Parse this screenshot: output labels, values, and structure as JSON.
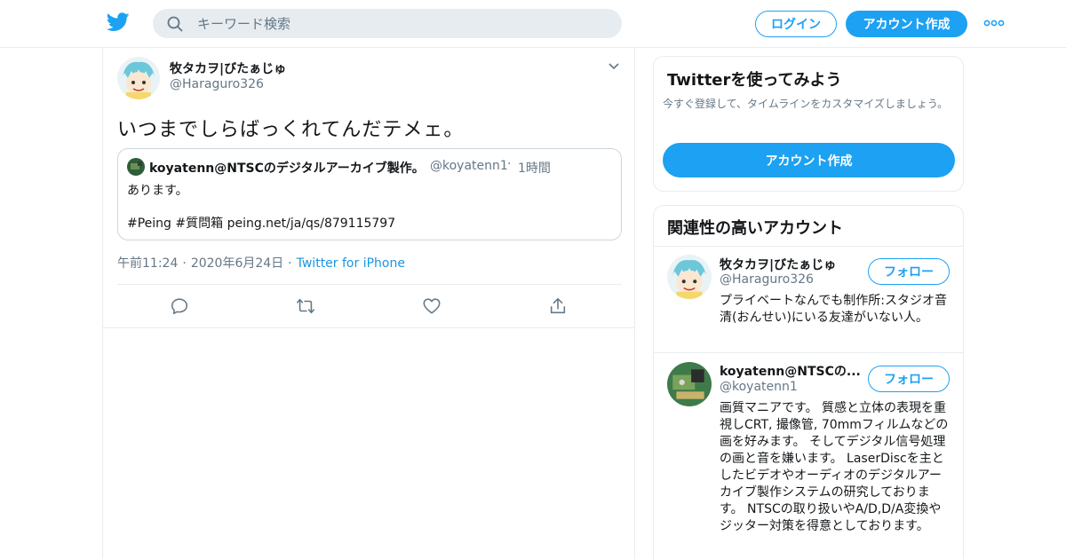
{
  "header": {
    "search_placeholder": "キーワード検索",
    "login_label": "ログイン",
    "signup_label": "アカウント作成",
    "icons": {
      "logo": "twitter-bird-icon",
      "search": "magnifier-icon",
      "more": "more-dots-icon"
    },
    "accent_color": "#1da1f2"
  },
  "tweet": {
    "author_name": "牧タカヲ|びたぁじゅ",
    "author_handle": "@Haraguro326",
    "text": "いつまでしらばっくれてんだテメェ。",
    "quote": {
      "author_name": "koyatenn@NTSCのデジタルアーカイブ製作。",
      "author_handle": "@koyatenn1",
      "dot": "·",
      "time": "1時間",
      "line1": "あります。",
      "line2": "#Peing #質問箱 peing.net/ja/qs/879115797"
    },
    "time": "午前11:24",
    "sep": "·",
    "date": "2020年6月24日",
    "source": "Twitter for iPhone",
    "actions": [
      "reply-icon",
      "retweet-icon",
      "like-icon",
      "share-icon"
    ]
  },
  "sidebar": {
    "signup_card": {
      "title": "Twitterを使ってみよう",
      "description": "今すぐ登録して、タイムラインをカスタマイズしましょう。",
      "button_label": "アカウント作成"
    },
    "related": {
      "title": "関連性の高いアカウント",
      "accounts": [
        {
          "name": "牧タカヲ|びたぁじゅ",
          "handle": "@Haraguro326",
          "follow_label": "フォロー",
          "bio": "プライベートなんでも制作所:スタジオ音清(おんせい)にいる友達がいない人。"
        },
        {
          "name": "koyatenn@NTSCの...",
          "handle": "@koyatenn1",
          "follow_label": "フォロー",
          "bio": "画質マニアです。 質感と立体の表現を重視しCRT, 撮像管, 70mmフィルムなどの画を好みます。 そしてデジタル信号処理の画と音を嫌います。 LaserDiscを主としたビデオやオーディオのデジタルアーカイブ製作システムの研究しております。 NTSCの取り扱いやA/D,D/A変換やジッター対策を得意としております。"
        }
      ]
    }
  }
}
